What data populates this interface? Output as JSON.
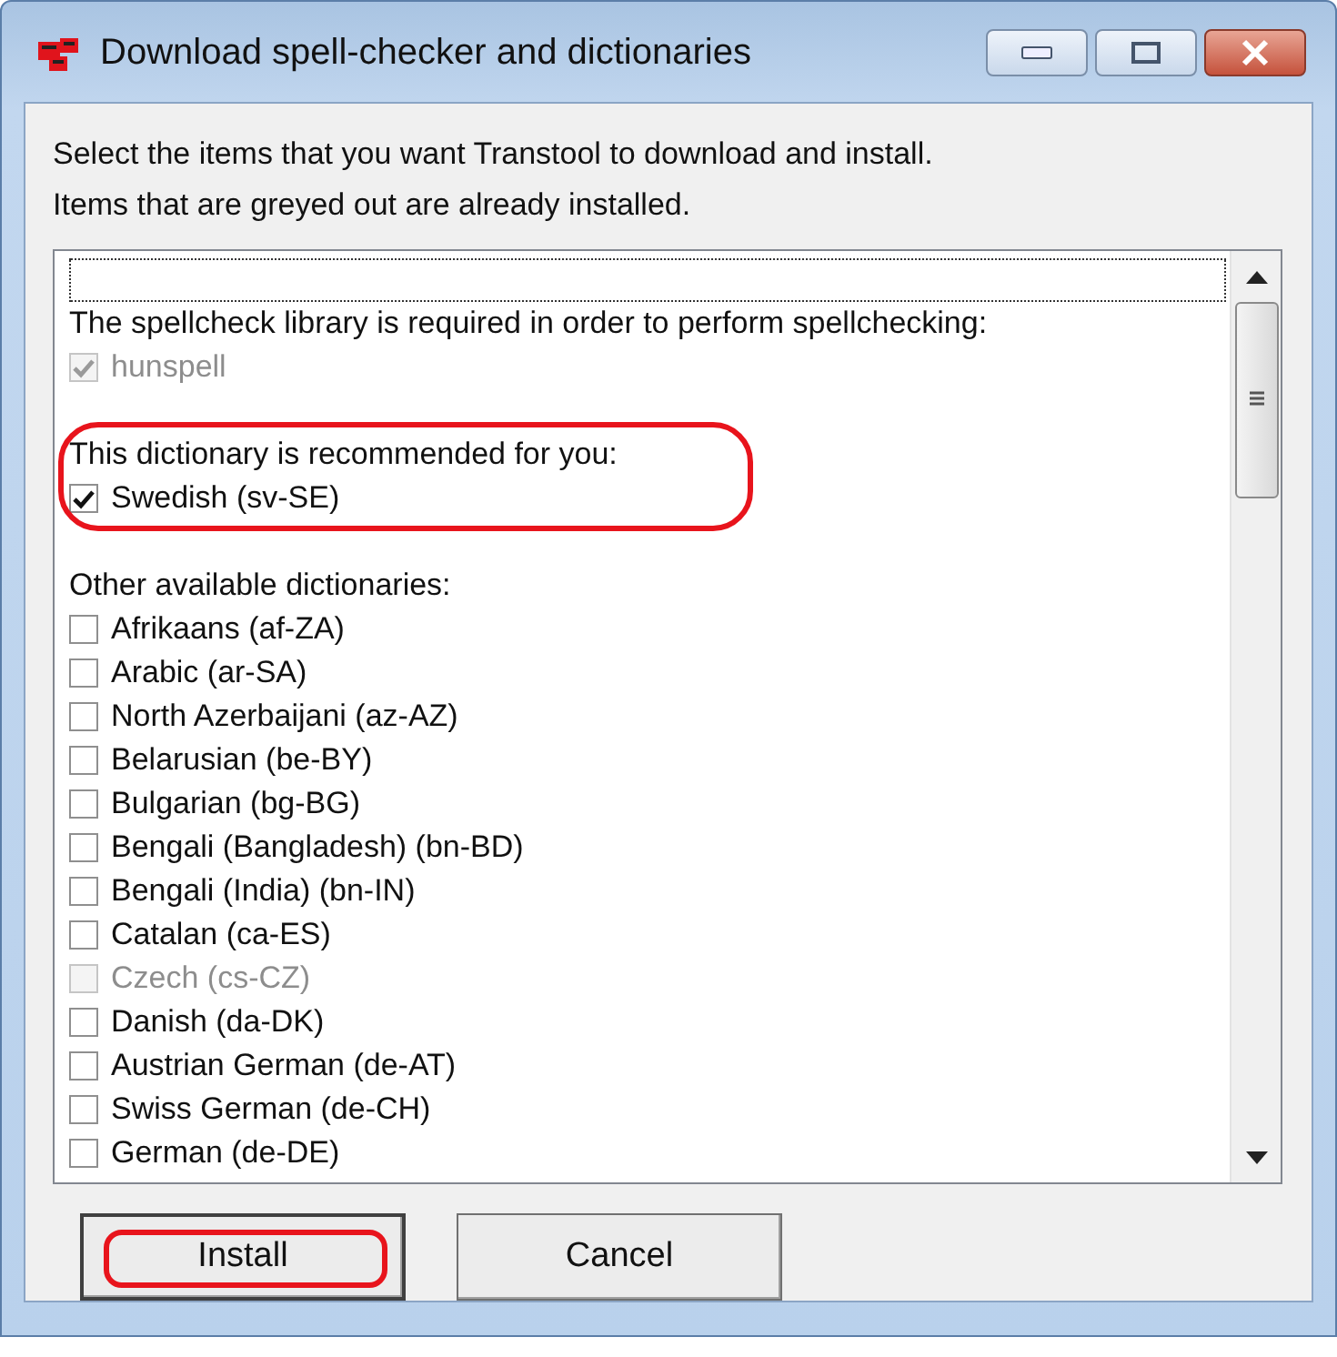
{
  "window": {
    "title": "Download spell-checker and dictionaries"
  },
  "intro": [
    "Select the items that you want Transtool to download and install.",
    "Items that are greyed out are already installed."
  ],
  "sections": [
    {
      "heading": "The spellcheck library is required in order to perform spellchecking:",
      "highlighted": false,
      "items": [
        {
          "label": "hunspell",
          "checked": true,
          "disabled": true
        }
      ]
    },
    {
      "heading": "This dictionary is recommended for you:",
      "highlighted": true,
      "items": [
        {
          "label": "Swedish (sv-SE)",
          "checked": true,
          "disabled": false
        }
      ]
    },
    {
      "heading": "Other available dictionaries:",
      "highlighted": false,
      "items": [
        {
          "label": "Afrikaans (af-ZA)",
          "checked": false,
          "disabled": false
        },
        {
          "label": "Arabic (ar-SA)",
          "checked": false,
          "disabled": false
        },
        {
          "label": "North Azerbaijani (az-AZ)",
          "checked": false,
          "disabled": false
        },
        {
          "label": "Belarusian (be-BY)",
          "checked": false,
          "disabled": false
        },
        {
          "label": "Bulgarian (bg-BG)",
          "checked": false,
          "disabled": false
        },
        {
          "label": "Bengali (Bangladesh) (bn-BD)",
          "checked": false,
          "disabled": false
        },
        {
          "label": "Bengali (India) (bn-IN)",
          "checked": false,
          "disabled": false
        },
        {
          "label": "Catalan (ca-ES)",
          "checked": false,
          "disabled": false
        },
        {
          "label": "Czech (cs-CZ)",
          "checked": false,
          "disabled": true
        },
        {
          "label": "Danish (da-DK)",
          "checked": false,
          "disabled": false
        },
        {
          "label": "Austrian German (de-AT)",
          "checked": false,
          "disabled": false
        },
        {
          "label": "Swiss German (de-CH)",
          "checked": false,
          "disabled": false
        },
        {
          "label": "German (de-DE)",
          "checked": false,
          "disabled": false
        }
      ]
    }
  ],
  "buttons": [
    {
      "label": "Install",
      "highlighted": true
    },
    {
      "label": "Cancel",
      "highlighted": false
    }
  ]
}
